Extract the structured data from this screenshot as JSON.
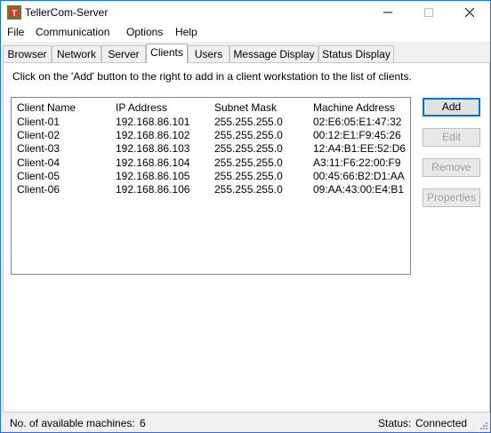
{
  "window": {
    "title": "TellerCom-Server",
    "controls": {
      "minimize": "—",
      "maximize": "☐",
      "close": "✕"
    }
  },
  "menu": [
    "File",
    "Communication",
    "Options",
    "Help"
  ],
  "tabs": [
    {
      "label": "Browser"
    },
    {
      "label": "Network"
    },
    {
      "label": "Server"
    },
    {
      "label": "Clients",
      "active": true
    },
    {
      "label": "Users"
    },
    {
      "label": "Message Display"
    },
    {
      "label": "Status Display"
    }
  ],
  "clients_tab": {
    "instruction": "Click on the 'Add' button to the right to add in a client workstation to the list of clients.",
    "columns": [
      "Client Name",
      "IP Address",
      "Subnet Mask",
      "Machine Address"
    ],
    "rows": [
      [
        "Client-01",
        "192.168.86.101",
        "255.255.255.0",
        "02:E6:05:E1:47:32"
      ],
      [
        "Client-02",
        "192.168.86.102",
        "255.255.255.0",
        "00:12:E1:F9:45:26"
      ],
      [
        "Client-03",
        "192.168.86.103",
        "255.255.255.0",
        "12:A4:B1:EE:52:D6"
      ],
      [
        "Client-04",
        "192.168.86.104",
        "255.255.255.0",
        "A3:11:F6:22:00:F9"
      ],
      [
        "Client-05",
        "192.168.86.105",
        "255.255.255.0",
        "00:45:66:B2:D1:AA"
      ],
      [
        "Client-06",
        "192.168.86.106",
        "255.255.255.0",
        "09:AA:43:00:E4:B1"
      ]
    ],
    "buttons": {
      "add": {
        "label": "Add",
        "enabled": true
      },
      "edit": {
        "label": "Edit",
        "enabled": false
      },
      "remove": {
        "label": "Remove",
        "enabled": false
      },
      "properties": {
        "label": "Properties",
        "enabled": false
      }
    }
  },
  "status_bar": {
    "available_label": "No. of available machines:",
    "available_count": "6",
    "status_label": "Status:",
    "status_value": "Connected"
  },
  "colors": {
    "accent": "#0078d7",
    "icon_green": "#3c8c3c",
    "icon_red": "#d83b2b"
  }
}
